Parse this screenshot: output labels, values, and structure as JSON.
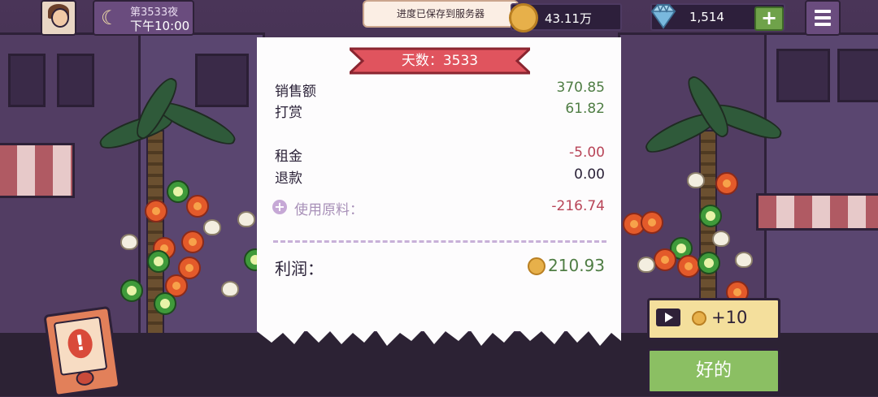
{
  "hud": {
    "day_night_label": "第3533夜",
    "time_label": "下午10:00",
    "toast": "进度已保存到服务器",
    "coins": "43.11万",
    "gems": "1,514",
    "gem_add_label": "+"
  },
  "receipt": {
    "day_banner": "天数：3533",
    "rows": [
      {
        "label": "销售额",
        "value": "370.85"
      },
      {
        "label": "打赏",
        "value": "61.82"
      },
      {
        "label": "租金",
        "value": "-5.00"
      },
      {
        "label": "退款",
        "value": "0.00"
      },
      {
        "label": "使用原料：",
        "value": "-216.74"
      }
    ],
    "profit_label": "利润：",
    "profit_value": "210.93"
  },
  "actions": {
    "ad_reward": "+10",
    "ok": "好的"
  },
  "colors": {
    "positive": "#4f7d44",
    "negative": "#b84457",
    "banner": "#e0545e",
    "ok_button": "#8bbf63",
    "ad_button": "#f4df9c"
  }
}
